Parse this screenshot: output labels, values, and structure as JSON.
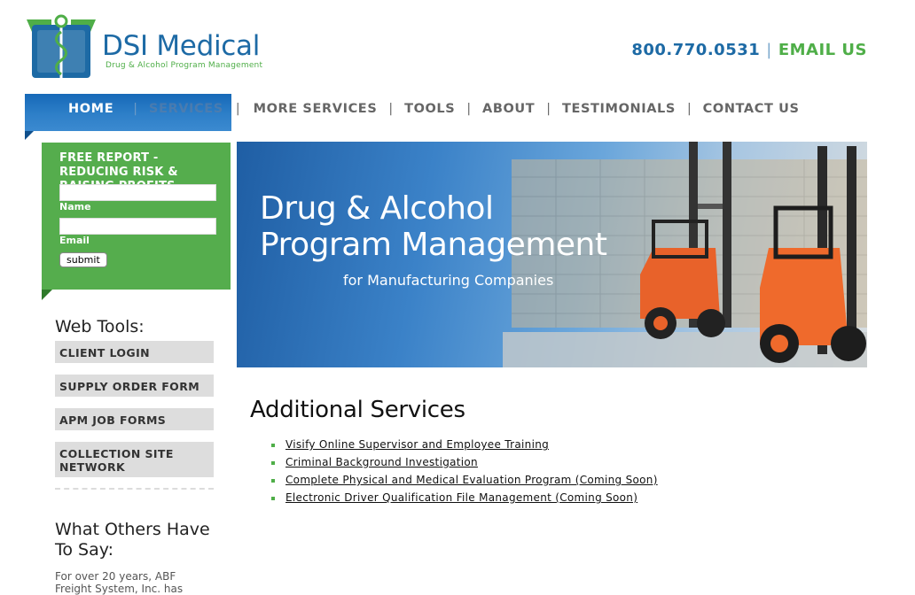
{
  "header": {
    "logo_name": "DSI Medical",
    "logo_tagline": "Drug & Alcohol Program Management",
    "phone": "800.770.0531",
    "separator": "|",
    "email_label": "EMAIL US",
    "colors": {
      "brand_blue": "#1d6aa5",
      "brand_green": "#4fae48"
    }
  },
  "nav": {
    "items": [
      "HOME",
      "SERVICES",
      "MORE SERVICES",
      "TOOLS",
      "ABOUT",
      "TESTIMONIALS",
      "CONTACT US"
    ],
    "separator": "|",
    "active": "HOME"
  },
  "report_form": {
    "title": "FREE REPORT - REDUCING RISK & RAISING PROFITS",
    "name_label": "Name",
    "email_label": "Email",
    "name_value": "",
    "email_value": "",
    "submit_label": "submit"
  },
  "web_tools": {
    "heading": "Web Tools:",
    "buttons": [
      "CLIENT LOGIN",
      "SUPPLY ORDER FORM",
      "APM JOB FORMS",
      "COLLECTION SITE NETWORK"
    ]
  },
  "testimonials": {
    "heading": "What Others Have To Say:",
    "text": "For over 20 years, ABF Freight System, Inc. has"
  },
  "hero": {
    "title_line1": "Drug & Alcohol",
    "title_line2": "Program Management",
    "subtitle": "for Manufacturing Companies"
  },
  "content": {
    "section_title": "Additional Services",
    "services": [
      "Visify Online Supervisor and Employee Training",
      "Criminal Background Investigation",
      "Complete Physical and Medical Evaluation Program (Coming Soon)",
      "Electronic Driver Qualification File Management (Coming Soon)"
    ]
  }
}
